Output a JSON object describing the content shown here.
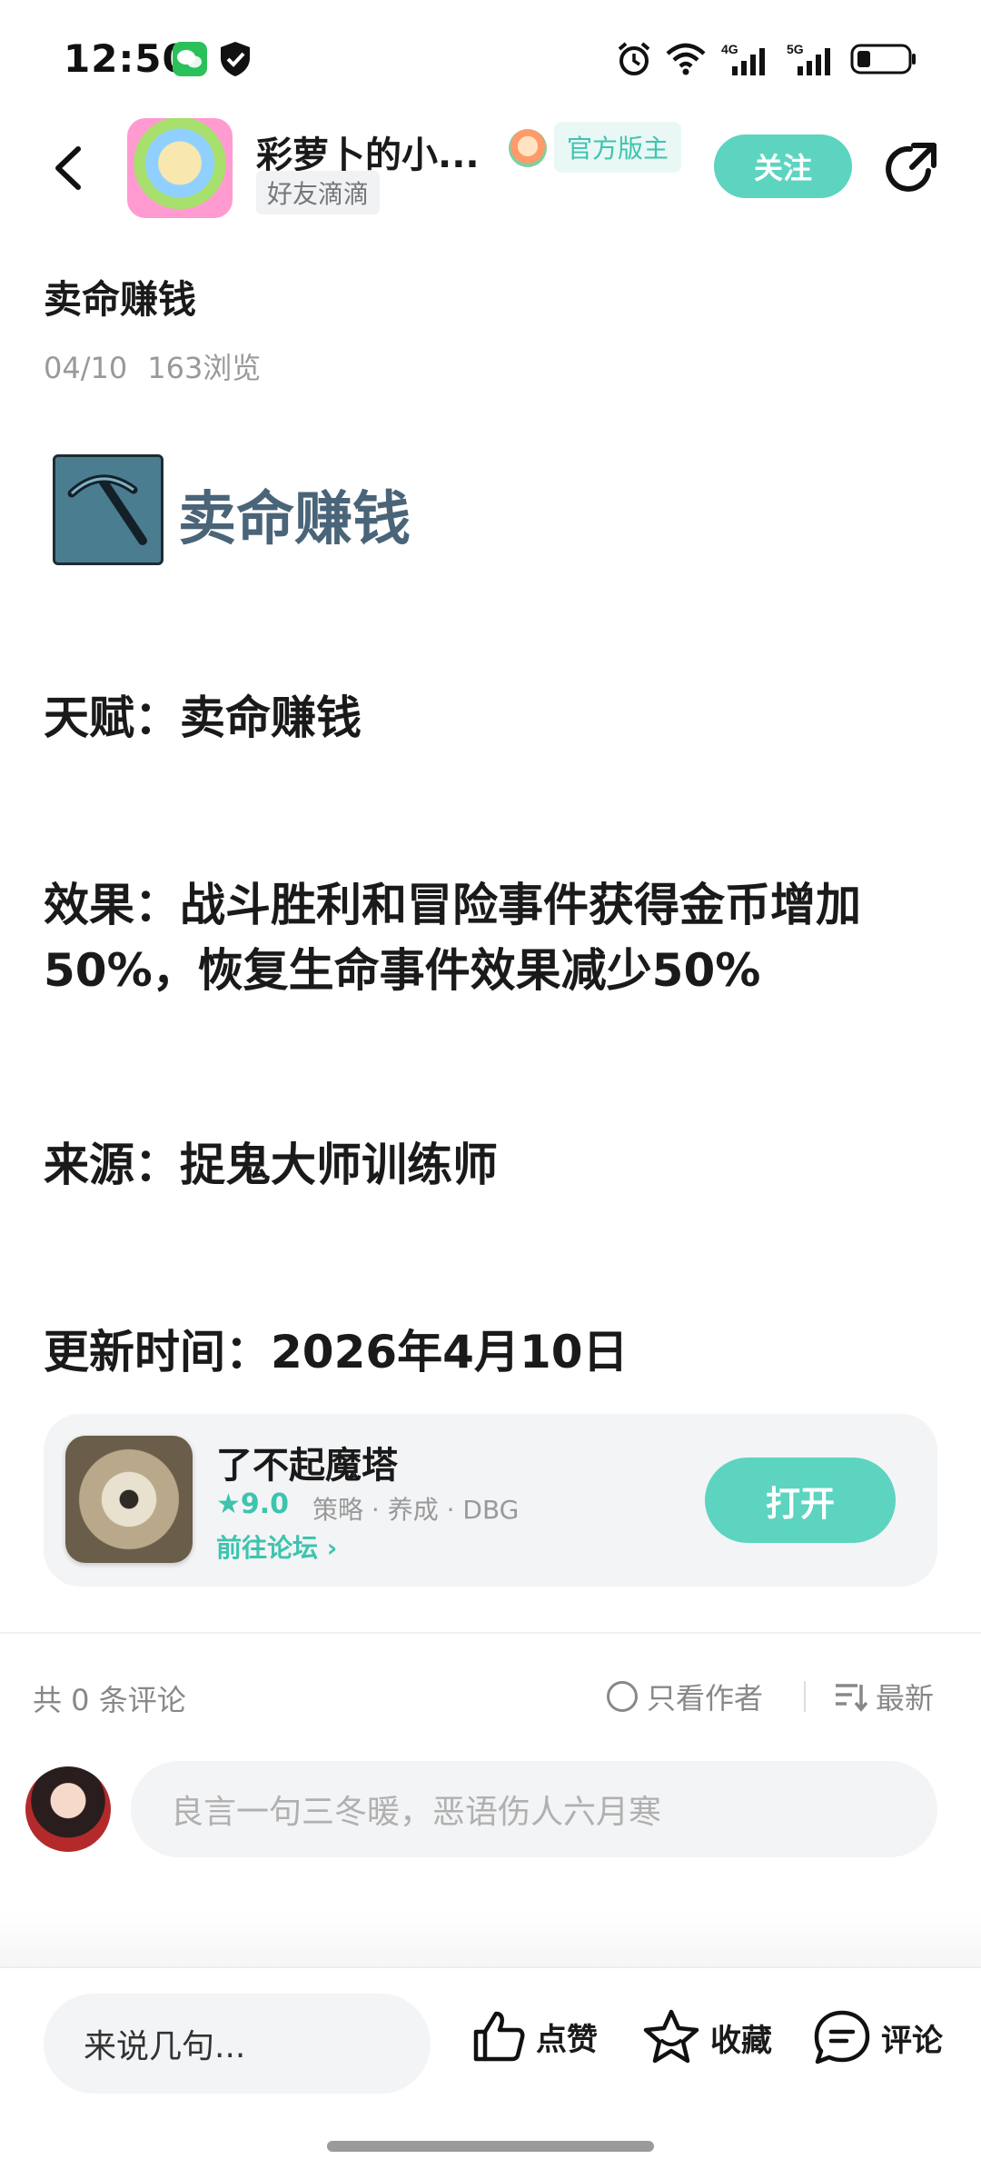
{
  "status_bar": {
    "time": "12:50",
    "icons": [
      "wechat-icon",
      "shield-icon",
      "alarm-icon",
      "wifi-icon",
      "signal-4g-icon",
      "signal-5g-icon",
      "battery-icon"
    ],
    "network_labels": [
      "4G",
      "5G"
    ]
  },
  "header": {
    "forum_title": "彩萝卜的小...",
    "forum_subtag": "好友滴滴",
    "official_badge": "官方版主",
    "follow_label": "关注"
  },
  "post": {
    "title": "卖命赚钱",
    "date": "04/10",
    "views": "163浏览",
    "talent_heading": "卖命赚钱",
    "talent_line": "天赋：卖命赚钱",
    "effect_line": "效果：战斗胜利和冒险事件获得金币增加50%，恢复生命事件效果减少50%",
    "source_line": "来源：捉鬼大师训练师",
    "update_line": "更新时间：2026年4月10日"
  },
  "game_card": {
    "name": "了不起魔塔",
    "rating": "★9.0",
    "tags": "策略 · 养成 · DBG",
    "forum_link": "前往论坛 ›",
    "open_label": "打开"
  },
  "comments": {
    "count_text": "共 0 条评论",
    "author_only": "只看作者",
    "sort_label": "最新",
    "input_placeholder": "良言一句三冬暖，恶语伤人六月寒"
  },
  "bottom_bar": {
    "say_placeholder": "来说几句...",
    "like_label": "点赞",
    "favorite_label": "收藏",
    "comment_label": "评论"
  },
  "colors": {
    "accent": "#5cd4c0",
    "accent_text": "#3cc4ae",
    "talent_heading": "#4a6478"
  }
}
